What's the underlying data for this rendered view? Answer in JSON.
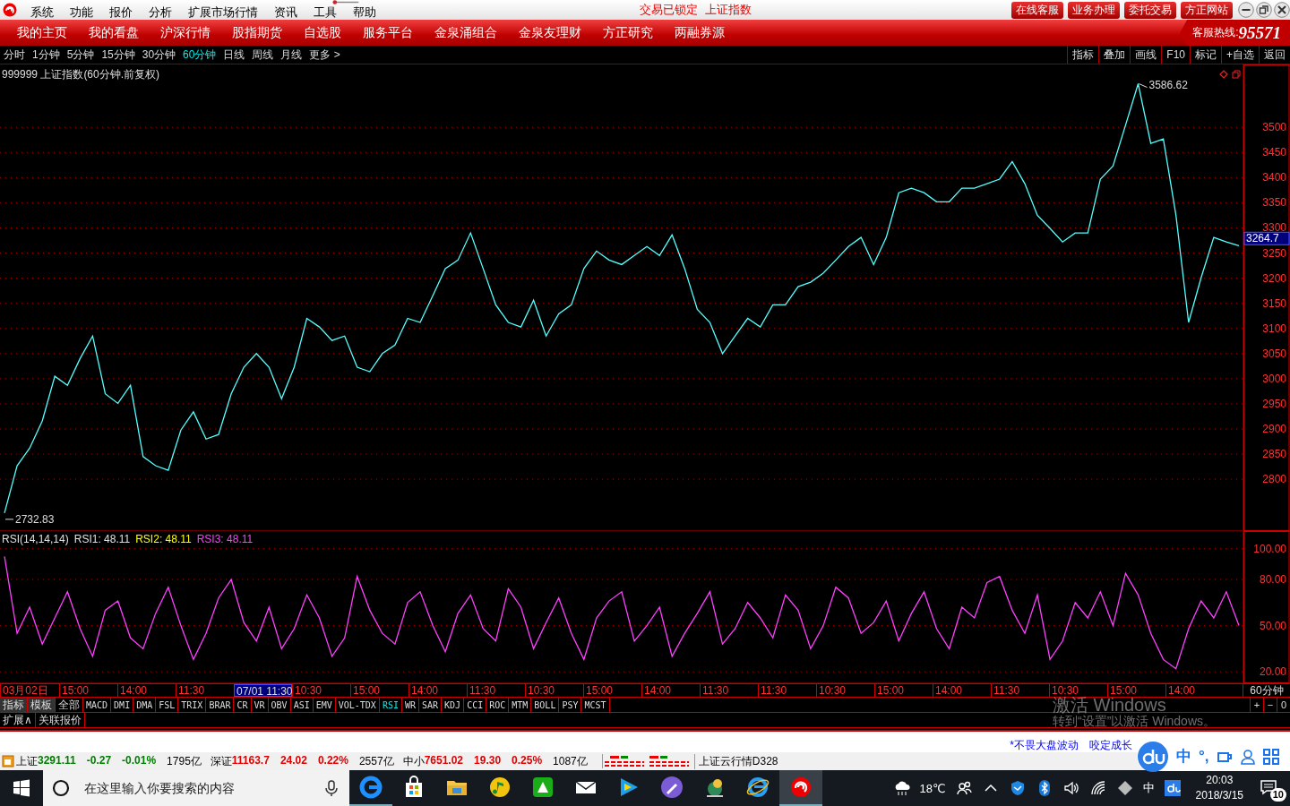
{
  "menu_bar": {
    "items": [
      "系统",
      "功能",
      "报价",
      "分析",
      "扩展市场行情",
      "资讯",
      "工具",
      "帮助"
    ],
    "status_texts": [
      "交易已锁定",
      "上证指数"
    ],
    "buttons": [
      "在线客服",
      "业务办理",
      "委托交易",
      "方正网站"
    ]
  },
  "nav_bar": {
    "items": [
      {
        "label": "我的主页",
        "selected": false
      },
      {
        "label": "我的看盘",
        "selected": false
      },
      {
        "label": "沪深行情",
        "selected": false
      },
      {
        "label": "股指期货",
        "selected": false
      },
      {
        "label": "自选股",
        "selected": false
      },
      {
        "label": "服务平台",
        "selected": false
      },
      {
        "label": "金泉涌组合",
        "selected": false
      },
      {
        "label": "金泉友理财",
        "selected": false
      },
      {
        "label": "方正研究",
        "selected": false
      },
      {
        "label": "两融券源",
        "selected": false
      }
    ],
    "hotline_label": "客服热线:",
    "hotline_number": "95571"
  },
  "period_bar": {
    "periods": [
      {
        "label": "分时",
        "selected": false
      },
      {
        "label": "1分钟",
        "selected": false
      },
      {
        "label": "5分钟",
        "selected": false
      },
      {
        "label": "15分钟",
        "selected": false
      },
      {
        "label": "30分钟",
        "selected": false
      },
      {
        "label": "60分钟",
        "selected": true
      },
      {
        "label": "日线",
        "selected": false
      },
      {
        "label": "周线",
        "selected": false
      },
      {
        "label": "月线",
        "selected": false
      },
      {
        "label": "更多 >",
        "selected": false
      }
    ],
    "tools": [
      "指标",
      "叠加",
      "画线",
      "F10",
      "标记",
      "+自选",
      "返回"
    ]
  },
  "price_chart": {
    "title": "999999 上证指数(60分钟.前复权)",
    "last_price": "3264.7",
    "chart_data": {
      "type": "line",
      "grid": true,
      "ylim": [
        2697,
        3625
      ],
      "yticks": [
        2800,
        2850,
        2900,
        2950,
        3000,
        3050,
        3100,
        3150,
        3200,
        3250,
        3300,
        3350,
        3400,
        3450,
        3500
      ],
      "series": [
        {
          "color": "#54ffff",
          "values": [
            2732.83,
            2827,
            2862,
            2916,
            3005,
            2987,
            3040,
            3085,
            2970,
            2951,
            2987,
            2845,
            2827,
            2818,
            2898,
            2934,
            2880,
            2889,
            2970,
            3023,
            3050,
            3023,
            2960,
            3023,
            3120,
            3103,
            3076,
            3085,
            3023,
            3014,
            3050,
            3067,
            3120,
            3112,
            3165,
            3219,
            3236,
            3290,
            3219,
            3147,
            3112,
            3103,
            3156,
            3085,
            3129,
            3147,
            3219,
            3254,
            3236,
            3227,
            3245,
            3263,
            3245,
            3286,
            3219,
            3138,
            3112,
            3050,
            3085,
            3120,
            3103,
            3147,
            3147,
            3183,
            3192,
            3210,
            3236,
            3263,
            3281,
            3227,
            3281,
            3370,
            3379,
            3370,
            3352,
            3352,
            3379,
            3379,
            3388,
            3397,
            3432,
            3388,
            3325,
            3299,
            3272,
            3290,
            3290,
            3397,
            3423,
            3504,
            3586.62,
            3468,
            3477,
            3325,
            3112,
            3201,
            3281,
            3272,
            3264.7
          ]
        }
      ],
      "annotations": [
        "3586.62",
        "2732.83"
      ]
    }
  },
  "rsi_chart": {
    "legend": [
      {
        "label": "RSI(14,14,14)",
        "color": "#e0e0e0"
      },
      {
        "label": "RSI1: 48.11",
        "color": "#e0e0e0"
      },
      {
        "label": "RSI2: 48.11",
        "color": "#ffff00"
      },
      {
        "label": "RSI3: 48.11",
        "color": "#ff40ff"
      }
    ],
    "chart_data": {
      "type": "line",
      "grid": true,
      "ylim": [
        12.5,
        111.5
      ],
      "yticks": [
        {
          "value": 20,
          "label": "20.00"
        },
        {
          "value": 50,
          "label": "50.00"
        },
        {
          "value": 80,
          "label": "80.00"
        },
        {
          "value": 100,
          "label": "100.00"
        }
      ],
      "series": [
        {
          "color": "#ff40ff",
          "values": [
            95,
            45,
            62,
            38,
            55,
            72,
            48,
            30,
            60,
            66,
            42,
            35,
            58,
            75,
            50,
            28,
            45,
            68,
            80,
            52,
            40,
            62,
            35,
            48,
            70,
            55,
            30,
            42,
            82,
            60,
            45,
            38,
            65,
            72,
            50,
            33,
            58,
            70,
            48,
            40,
            74,
            62,
            35,
            52,
            68,
            45,
            28,
            55,
            66,
            72,
            40,
            50,
            62,
            30,
            45,
            58,
            72,
            38,
            48,
            65,
            55,
            42,
            70,
            60,
            35,
            50,
            75,
            68,
            45,
            52,
            66,
            40,
            58,
            72,
            48,
            35,
            62,
            55,
            78,
            82,
            60,
            45,
            70,
            28,
            40,
            65,
            55,
            72,
            50,
            84,
            70,
            45,
            28,
            22,
            48,
            66,
            55,
            72,
            50
          ]
        }
      ]
    }
  },
  "time_axis": {
    "labels": [
      {
        "label": "03月02日",
        "kind": "date"
      },
      {
        "label": "15:00",
        "kind": "time"
      },
      {
        "label": "14:00",
        "kind": "time"
      },
      {
        "label": "11:30",
        "kind": "time"
      },
      {
        "label": "07/01 11:30",
        "kind": "cursor"
      },
      {
        "label": "10:30",
        "kind": "time"
      },
      {
        "label": "15:00",
        "kind": "time"
      },
      {
        "label": "14:00",
        "kind": "time"
      },
      {
        "label": "11:30",
        "kind": "time"
      },
      {
        "label": "10:30",
        "kind": "time"
      },
      {
        "label": "15:00",
        "kind": "time"
      },
      {
        "label": "14:00",
        "kind": "time"
      },
      {
        "label": "11:30",
        "kind": "time"
      },
      {
        "label": "11:30",
        "kind": "time"
      },
      {
        "label": "10:30",
        "kind": "time"
      },
      {
        "label": "15:00",
        "kind": "time"
      },
      {
        "label": "14:00",
        "kind": "time"
      },
      {
        "label": "11:30",
        "kind": "time"
      },
      {
        "label": "10:30",
        "kind": "time"
      },
      {
        "label": "15:00",
        "kind": "time"
      },
      {
        "label": "14:00",
        "kind": "time"
      }
    ],
    "period": "60分钟"
  },
  "indicator_tabs": [
    {
      "label": "指标",
      "kind": "tool",
      "selected": false
    },
    {
      "label": "模板",
      "kind": "tool",
      "selected": false
    },
    {
      "label": "全部",
      "kind": "tab",
      "selected": false
    },
    {
      "label": "MACD",
      "kind": "tab",
      "selected": false
    },
    {
      "label": "DMI",
      "kind": "tab",
      "selected": false
    },
    {
      "label": "DMA",
      "kind": "tab",
      "selected": false
    },
    {
      "label": "FSL",
      "kind": "tab",
      "selected": false
    },
    {
      "label": "TRIX",
      "kind": "tab",
      "selected": false
    },
    {
      "label": "BRAR",
      "kind": "tab",
      "selected": false
    },
    {
      "label": "CR",
      "kind": "tab",
      "selected": false
    },
    {
      "label": "VR",
      "kind": "tab",
      "selected": false
    },
    {
      "label": "OBV",
      "kind": "tab",
      "selected": false
    },
    {
      "label": "ASI",
      "kind": "tab",
      "selected": false
    },
    {
      "label": "EMV",
      "kind": "tab",
      "selected": false
    },
    {
      "label": "VOL-TDX",
      "kind": "tab",
      "selected": false
    },
    {
      "label": "RSI",
      "kind": "tab",
      "selected": true
    },
    {
      "label": "WR",
      "kind": "tab",
      "selected": false
    },
    {
      "label": "SAR",
      "kind": "tab",
      "selected": false
    },
    {
      "label": "KDJ",
      "kind": "tab",
      "selected": false
    },
    {
      "label": "CCI",
      "kind": "tab",
      "selected": false
    },
    {
      "label": "ROC",
      "kind": "tab",
      "selected": false
    },
    {
      "label": "MTM",
      "kind": "tab",
      "selected": false
    },
    {
      "label": "BOLL",
      "kind": "tab",
      "selected": false
    },
    {
      "label": "PSY",
      "kind": "tab",
      "selected": false
    },
    {
      "label": "MCST",
      "kind": "tab",
      "selected": false
    }
  ],
  "zoom_buttons": [
    "+",
    "−",
    "0"
  ],
  "extra_tabs": [
    "扩展∧",
    "关联报价"
  ],
  "activation_notice": {
    "title": "激活 Windows",
    "text": "转到“设置”以激活 Windows。"
  },
  "ticker": [
    "*不畏大盘波动",
    "咬定成长"
  ],
  "ime_toolbar": {
    "items": [
      "中",
      "°,"
    ]
  },
  "status_bar": {
    "indices": [
      {
        "name": "上证",
        "value": "3291.11",
        "change": "-0.27",
        "percent": "-0.01%",
        "amount": "1795亿",
        "color": "#008000"
      },
      {
        "name": "深证",
        "value": "11163.7",
        "change": "24.02",
        "percent": "0.22%",
        "amount": "2557亿",
        "color": "#e00000"
      },
      {
        "name": "中小",
        "value": "7651.02",
        "change": "19.30",
        "percent": "0.25%",
        "amount": "1087亿",
        "color": "#e00000"
      }
    ],
    "feed": "上证云行情D328"
  },
  "taskbar": {
    "search_placeholder": "在这里输入你要搜索的内容",
    "weather": "18℃",
    "ime": "中",
    "time": "20:03",
    "date": "2018/3/15",
    "notifications": "10"
  }
}
